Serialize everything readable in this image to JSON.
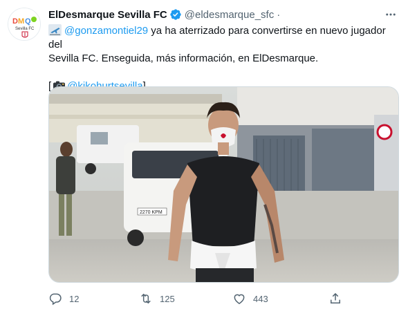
{
  "account": {
    "display_name": "ElDesmarque Sevilla FC",
    "handle": "@eldesmarque_sfc",
    "separator": "·",
    "avatar_brand": "DMQ",
    "avatar_caption": "Sevilla FC"
  },
  "tweet": {
    "mention_player": "@gonzamontiel29",
    "text_part1": " ya ha aterrizado para convertirse en nuevo jugador del",
    "text_part2": "Sevilla FC. Enseguida, más información, en ElDesmarque.",
    "credit_open": "[",
    "credit_mention": "@kikohurtsevilla",
    "credit_close": "]",
    "plane_icon": "airplane-departure-icon",
    "camera_icon": "camera-icon"
  },
  "photo": {
    "plate_text": "2270 KPM"
  },
  "actions": {
    "replies": "12",
    "retweets": "125",
    "likes": "443"
  },
  "colors": {
    "link": "#1d9bf0",
    "text": "#0f1419",
    "muted": "#536471",
    "verified": "#1d9bf0"
  }
}
